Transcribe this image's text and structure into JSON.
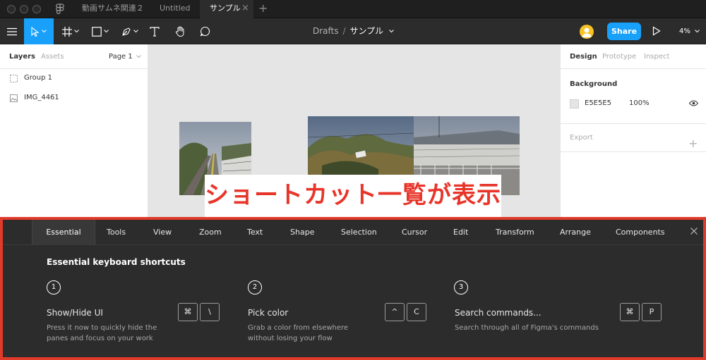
{
  "window": {
    "tabs": [
      {
        "label": "動画サムネ関連２"
      },
      {
        "label": "Untitled"
      },
      {
        "label": "サンプル"
      }
    ],
    "close_glyph": "×",
    "new_tab_glyph": "+"
  },
  "toolbar": {
    "breadcrumb_parent": "Drafts",
    "breadcrumb_sep": "/",
    "breadcrumb_file": "サンプル",
    "share_label": "Share",
    "zoom_label": "4%"
  },
  "left_panel": {
    "tabs": {
      "layers": "Layers",
      "assets": "Assets",
      "page": "Page 1"
    },
    "layers": [
      {
        "label": "Group 1",
        "icon": "frame-dashed-icon"
      },
      {
        "label": "IMG_4461",
        "icon": "image-icon"
      }
    ]
  },
  "canvas": {
    "background": "#E5E5E5",
    "caption": "ショートカット一覧が表示"
  },
  "right_panel": {
    "tabs": {
      "design": "Design",
      "prototype": "Prototype",
      "inspect": "Inspect"
    },
    "background_title": "Background",
    "bg_hex": "E5E5E5",
    "bg_opacity": "100%",
    "export_title": "Export"
  },
  "shortcut_panel": {
    "tabs": [
      "Essential",
      "Tools",
      "View",
      "Zoom",
      "Text",
      "Shape",
      "Selection",
      "Cursor",
      "Edit",
      "Transform",
      "Arrange",
      "Components"
    ],
    "active_tab": "Essential",
    "heading": "Essential keyboard shortcuts",
    "items": [
      {
        "step": "1",
        "title": "Show/Hide UI",
        "desc1": "Press it now to quickly hide the",
        "desc2": "panes and focus on your work",
        "keys": [
          "⌘",
          "\\"
        ]
      },
      {
        "step": "2",
        "title": "Pick color",
        "desc1": "Grab a color from elsewhere",
        "desc2": "without losing your flow",
        "keys": [
          "^",
          "C"
        ]
      },
      {
        "step": "3",
        "title": "Search commands...",
        "desc1": "Search through all of Figma's commands",
        "desc2": "",
        "keys": [
          "⌘",
          "P"
        ]
      }
    ]
  },
  "colors": {
    "accent": "#18A0FB",
    "highlight_border": "#E03A2A",
    "caption_red": "#E8352A",
    "avatar": "#F7C325"
  }
}
